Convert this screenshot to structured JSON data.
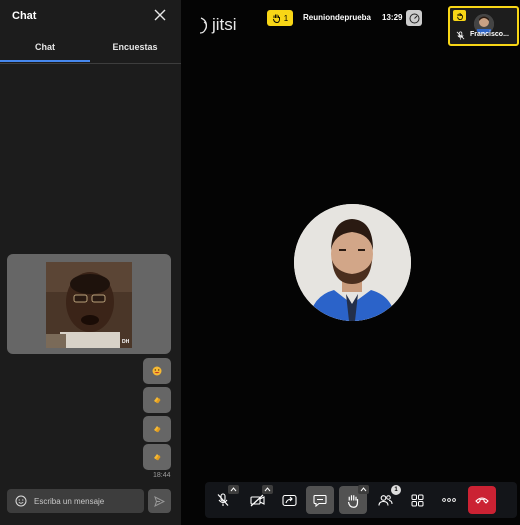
{
  "chat": {
    "title": "Chat",
    "tabs": [
      {
        "label": "Chat",
        "active": true
      },
      {
        "label": "Encuestas",
        "active": false
      }
    ],
    "messages": [
      {
        "type": "gif",
        "description_icon": "gif-image"
      },
      {
        "type": "emoji",
        "icon": "smiling-face-icon"
      },
      {
        "type": "emoji",
        "icon": "clapping-hands-icon"
      },
      {
        "type": "emoji",
        "icon": "clapping-hands-icon"
      },
      {
        "type": "emoji",
        "icon": "clapping-hands-icon"
      }
    ],
    "gif_watermark": "DH",
    "last_time": "18:44",
    "input_placeholder": "Escriba un mensaje"
  },
  "header": {
    "logo_text": "jitsi",
    "raised_hands_count": "1",
    "meeting_name": "Reuniondeprueba",
    "time": "13:29"
  },
  "thumbnail": {
    "name": "Francisco..."
  },
  "toolbar": {
    "participants_count": "1",
    "buttons": [
      "microphone-muted",
      "camera-off",
      "screen-share",
      "chat",
      "raise-hand",
      "participants",
      "tile-view",
      "more",
      "hangup"
    ]
  },
  "colors": {
    "accent": "#4687ed",
    "raised_hand": "#f8d616",
    "hangup": "#cb2233"
  }
}
